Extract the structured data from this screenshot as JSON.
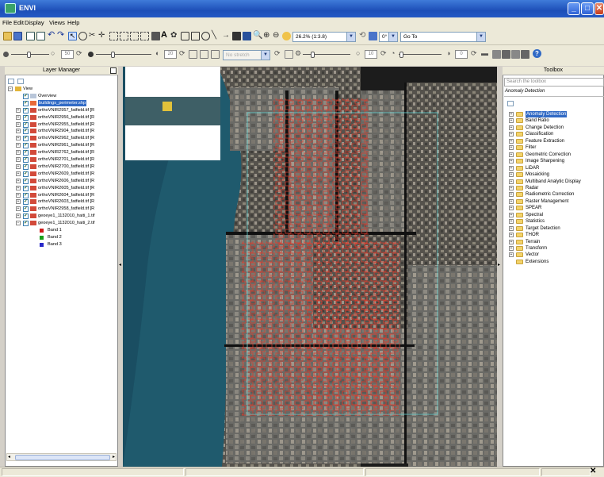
{
  "window": {
    "title": "ENVI",
    "btn_min": "_",
    "btn_max": "□",
    "btn_close": "✕"
  },
  "menu": [
    "File",
    "Edit",
    "Display",
    "Views",
    "Help"
  ],
  "toolbar": {
    "zoom_value": "26.2% (1:3.8)",
    "rotation_value": "0°",
    "goto_label": "Go To",
    "stretch_value": "No stretch",
    "brightness_value": "50",
    "contrast_value": "20",
    "transparency_value": "10",
    "sharpen_value": "0"
  },
  "layer_manager": {
    "title": "Layer Manager",
    "root_label": "View",
    "overview_label": "Overview",
    "selected_layer": "buildings_perimeter.shp",
    "ortho_layers": [
      "orthoVNIR2957_fatfield.tif [R",
      "orthoVNIR2956_fatfield.tif [R",
      "orthoVNIR2955_fatfield.tif [R",
      "orthoVNIR2904_fatfield.tif [R",
      "orthoVNIR2962_fatfield.tif [R",
      "orthoVNIR2961_fatfield.tif [R",
      "orthoVNIR2762_fatfield.tif [R",
      "orthoVNIR2701_fatfield.tif [R",
      "orthoVNIR2700_fatfield.tif [R",
      "orthoVNIR2609_fatfield.tif [R",
      "orthoVNIR2606_fatfield.tif [R",
      "orthoVNIR2605_fatfield.tif [R",
      "orthoVNIR2604_fatfield.tif [R",
      "orthoVNIR2603_fatfield.tif [R",
      "orthoVNIR2958_fatfield.tif [R"
    ],
    "geoeye_layers": [
      "geoeye1_1132010_haiti_1.tif",
      "geoeye1_1132010_haiti_2.tif"
    ],
    "bands": [
      {
        "label": "Band 1",
        "color": "#d01818"
      },
      {
        "label": "Band 2",
        "color": "#18a018"
      },
      {
        "label": "Band 3",
        "color": "#2828c8"
      }
    ]
  },
  "toolbox": {
    "title": "Toolbox",
    "search_placeholder": "Search the toolbox",
    "section_title": "Anomaly Detection",
    "items": [
      "Anomaly Detection",
      "Band Ratio",
      "Change Detection",
      "Classification",
      "Feature Extraction",
      "Filter",
      "Geometric Correction",
      "Image Sharpening",
      "LiDAR",
      "Mosaicking",
      "Multiband Analytic Display",
      "Radar",
      "Radiometric Correction",
      "Raster Management",
      "SPEAR",
      "Spectral",
      "Statistics",
      "Target Detection",
      "THOR",
      "Terrain",
      "Transform",
      "Vector",
      "Extensions"
    ],
    "selected_index": 0
  },
  "colors": {
    "accent": "#316ac5",
    "vector_outline": "#e03a2a",
    "selection_box": "#5fd0d0"
  }
}
